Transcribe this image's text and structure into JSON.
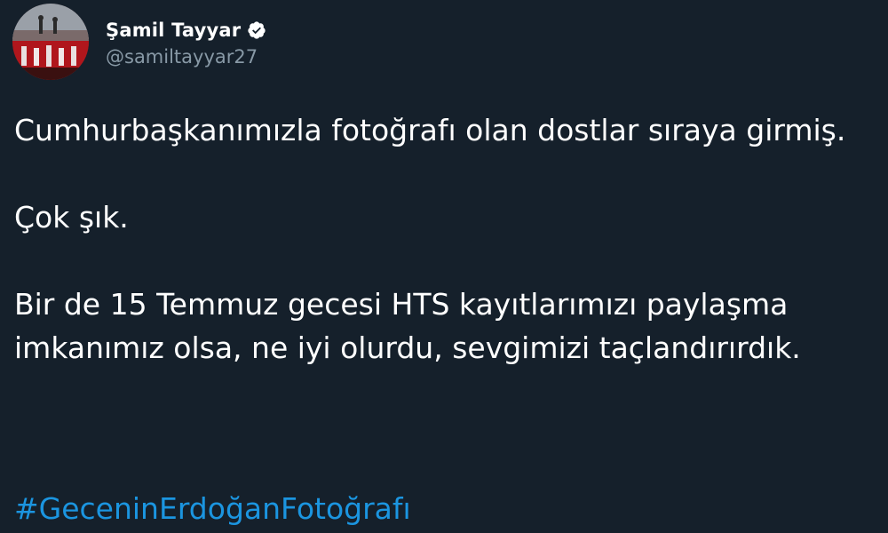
{
  "author": {
    "display_name": "Şamil Tayyar",
    "handle": "@samiltayyar27",
    "verified": true,
    "avatar_icon": "profile-photo"
  },
  "tweet": {
    "paragraphs": [
      "Cumhurbaşkanımızla fotoğrafı olan dostlar sıraya girmiş.",
      "Çok şık.",
      "Bir de 15 Temmuz gecesi HTS kayıtlarımızı paylaşma imkanımız olsa, ne iyi olurdu, sevgimizi taçlandırırdık."
    ],
    "hashtag": "#GeceninErdoğanFotoğrafı"
  },
  "colors": {
    "background": "#15202b",
    "text": "#ffffff",
    "secondary_text": "#8899a6",
    "link": "#1b95e0",
    "verified_badge": "#ffffff"
  }
}
